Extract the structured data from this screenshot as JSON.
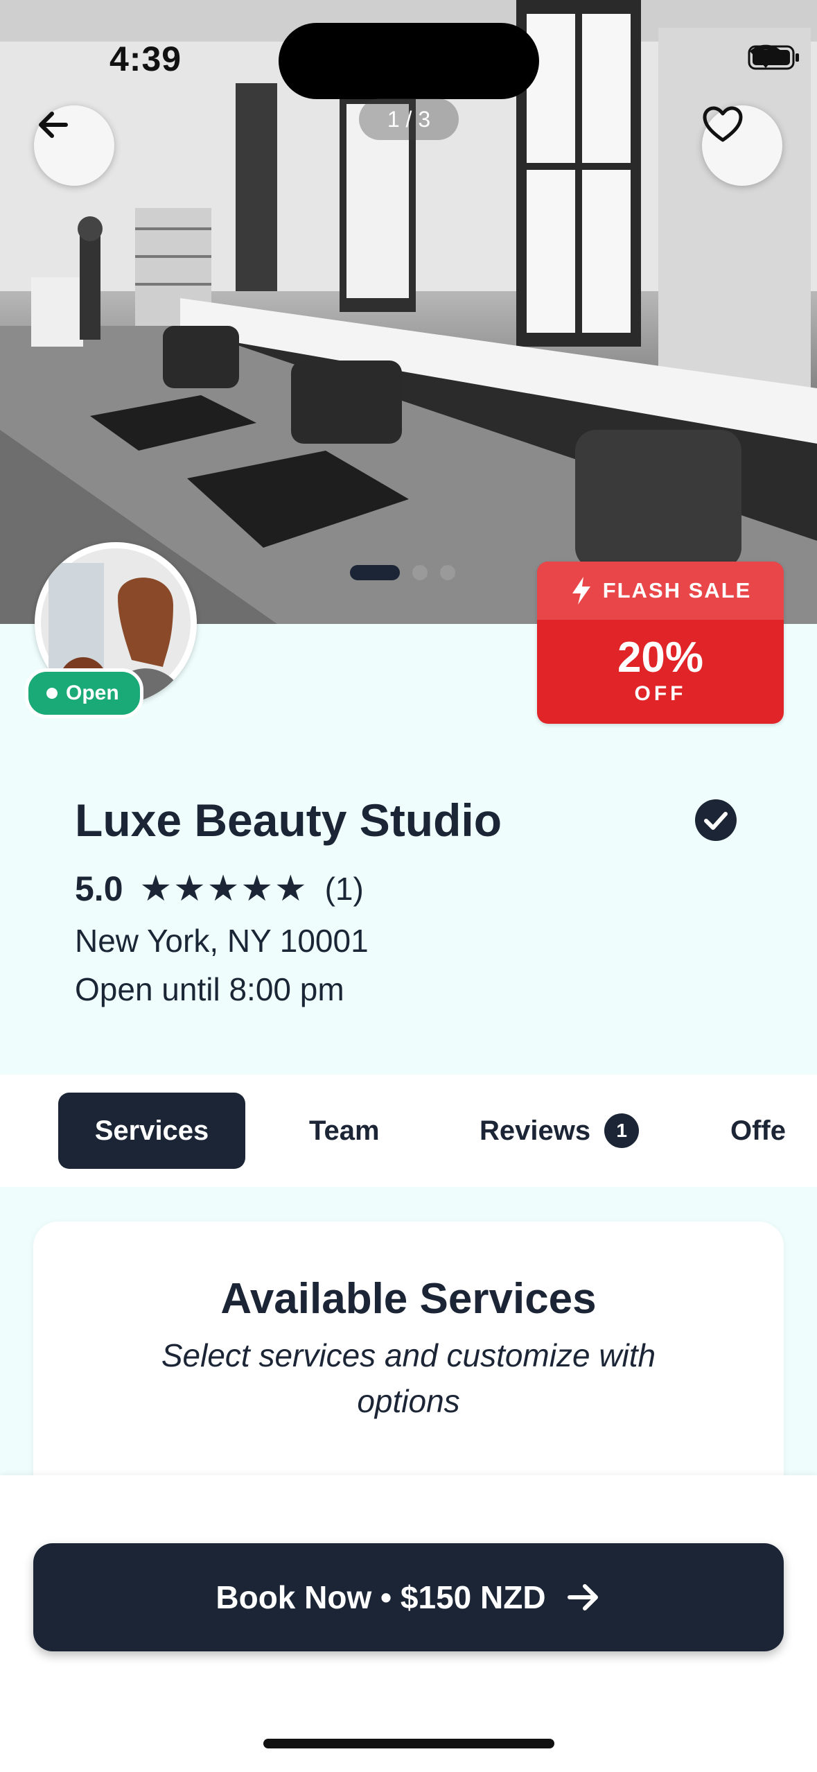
{
  "status_bar": {
    "time": "4:39"
  },
  "hero": {
    "image_counter": "1 / 3",
    "back_icon": "arrow-left-icon",
    "favorite_icon": "heart-icon",
    "total_images": 3,
    "active_image": 1
  },
  "business": {
    "name": "Luxe Beauty Studio",
    "open_status": "Open",
    "rating": "5.0",
    "stars": "★★★★★",
    "review_count": "(1)",
    "address": "New York, NY 10001",
    "hours": "Open until 8:00 pm",
    "verified_icon": "check-circle-icon"
  },
  "flash_sale": {
    "label": "FLASH SALE",
    "percent": "20%",
    "off": "OFF"
  },
  "tabs": [
    {
      "label": "Services",
      "active": true
    },
    {
      "label": "Team"
    },
    {
      "label": "Reviews",
      "badge": "1"
    },
    {
      "label": "Offe"
    }
  ],
  "services": {
    "title": "Available Services",
    "subtitle": "Select services and customize with options"
  },
  "book": {
    "label": "Book Now • $150 NZD"
  },
  "colors": {
    "primary": "#1b2535",
    "open_green": "#1aaa78",
    "flash_red": "#e02428",
    "info_bg": "#effdfd"
  }
}
